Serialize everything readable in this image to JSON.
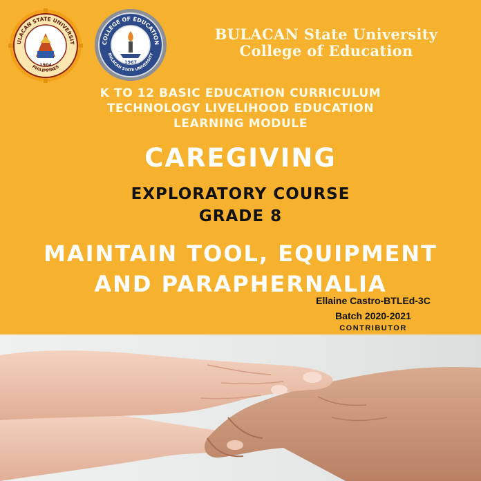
{
  "header": {
    "university_line1": "BULACAN State University",
    "university_line2": "College of Education",
    "seal_bsu": {
      "text": "BULACAN STATE UNIVERSITY",
      "country": "PHILIPPINES",
      "year": "1904"
    },
    "seal_coe": {
      "text": "COLLEGE OF EDUCATION",
      "sub": "BULACAN STATE UNIVERSITY",
      "year": "1967"
    }
  },
  "curriculum": {
    "line1": "K TO 12 BASIC EDUCATION CURRICULUM",
    "line2": "TECHNOLOGY LIVELIHOOD EDUCATION",
    "line3": "LEARNING MODULE"
  },
  "subject_title": "CAREGIVING",
  "course": {
    "name": "EXPLORATORY COURSE",
    "grade": "GRADE 8"
  },
  "module_title": {
    "line1": "MAINTAIN TOOL, EQUIPMENT",
    "line2": "AND PARAPHERNALIA"
  },
  "credits": {
    "author": "Ellaine Castro-BTLEd-3C",
    "batch": "Batch 2020-2021",
    "role": "CONTRIBUTOR"
  },
  "colors": {
    "background": "#f6b22f",
    "title_text": "#ffffff",
    "dark_text": "#111111"
  }
}
